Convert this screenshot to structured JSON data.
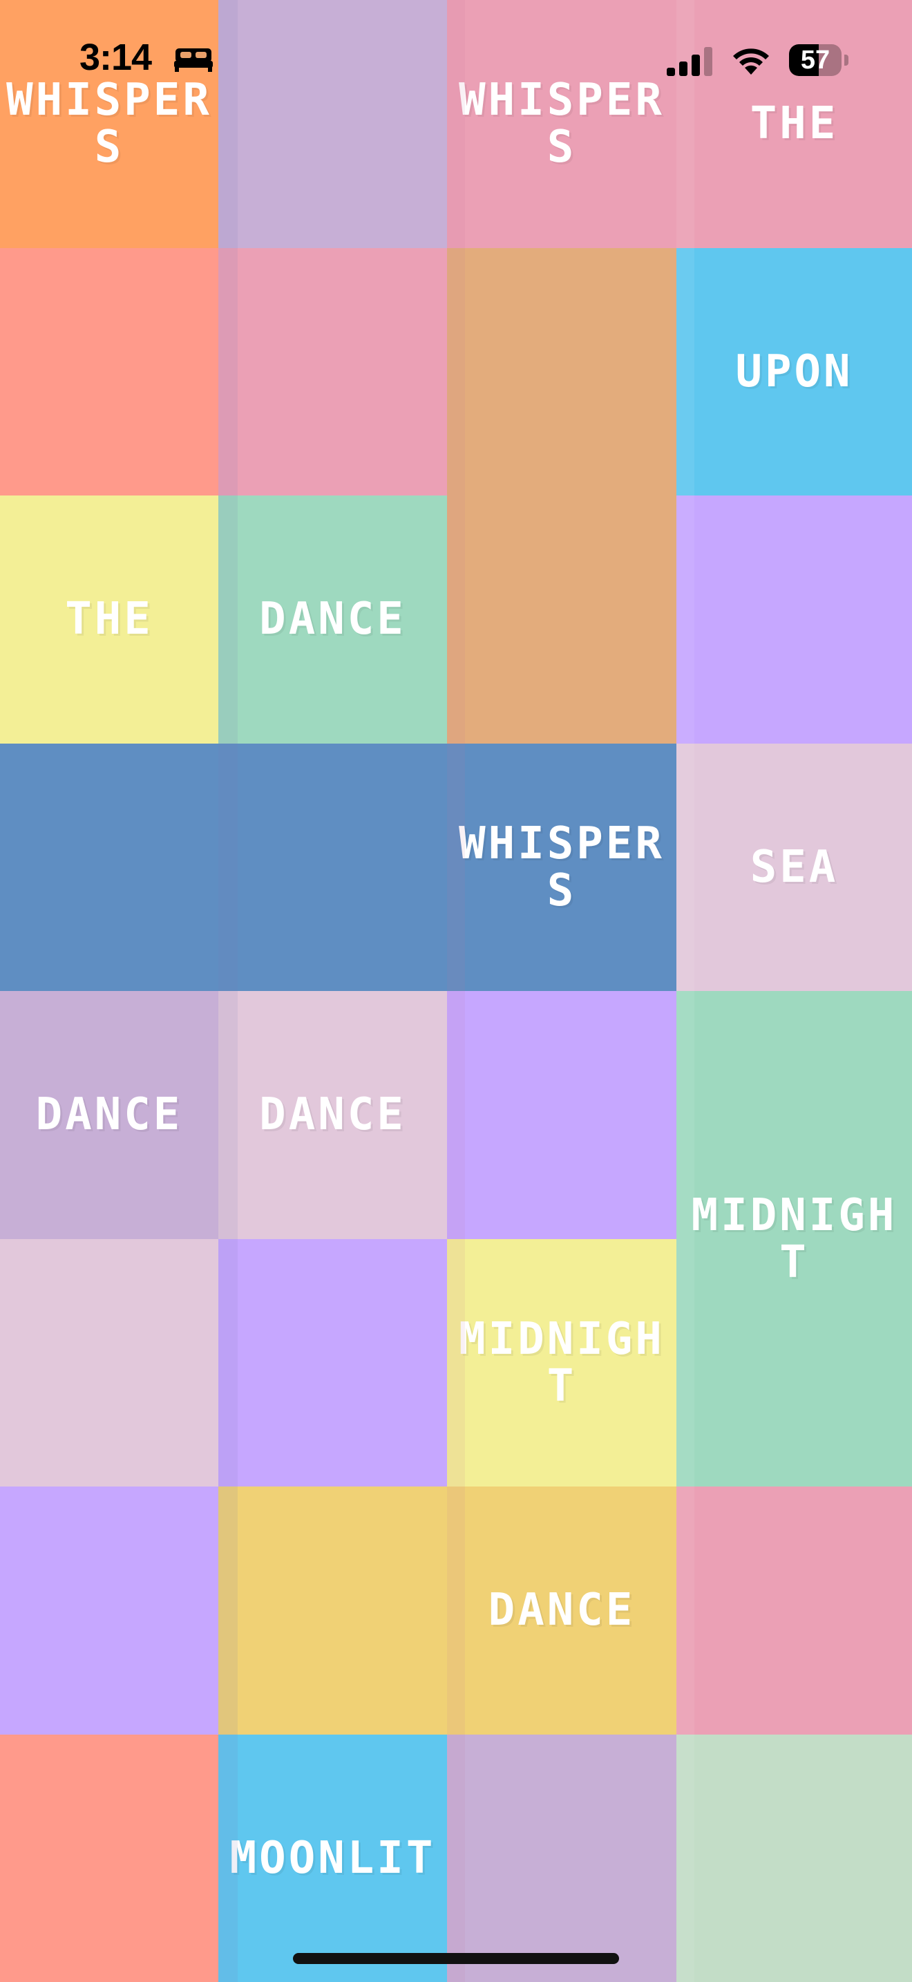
{
  "status_bar": {
    "time": "3:14",
    "battery_level": 57,
    "battery_label": "57"
  },
  "tiles": [
    {
      "word": "WHISPERS",
      "color": "#ffa162"
    },
    {
      "word": "",
      "color": "#c7afd6"
    },
    {
      "word": "WHISPERS",
      "color": "#eba0b5"
    },
    {
      "word": "THE",
      "color": "#eba0b5"
    },
    {
      "word": "",
      "color": "#ff9a8b"
    },
    {
      "word": "",
      "color": "#eba0b5"
    },
    {
      "word": "",
      "color": "#e3ac7c",
      "rowspan": 2
    },
    {
      "word": "UPON",
      "color": "#5fc7ef"
    },
    {
      "word": "THE",
      "color": "#f3ef96"
    },
    {
      "word": "DANCE",
      "color": "#9ed9bf"
    },
    {
      "word": "",
      "color": "#c6a7ff"
    },
    {
      "word": "",
      "color": "#5f8ec2"
    },
    {
      "word": "",
      "color": "#5f8ec2"
    },
    {
      "word": "WHISPERS",
      "color": "#5f8ec2"
    },
    {
      "word": "SEA",
      "color": "#e2c8db"
    },
    {
      "word": "DANCE",
      "color": "#c7afd6"
    },
    {
      "word": "DANCE",
      "color": "#e2c8db"
    },
    {
      "word": "",
      "color": "#c6a7ff"
    },
    {
      "word": "MIDNIGHT",
      "color": "#9ed9bf",
      "rowspan": 2
    },
    {
      "word": "",
      "color": "#e2c8db"
    },
    {
      "word": "",
      "color": "#c6a7ff"
    },
    {
      "word": "MIDNIGHT",
      "color": "#f3ef96"
    },
    {
      "word": "",
      "color": "#c6a7ff"
    },
    {
      "word": "",
      "color": "#f0d175"
    },
    {
      "word": "DANCE",
      "color": "#f0d175"
    },
    {
      "word": "",
      "color": "#eba0b5"
    },
    {
      "word": "",
      "color": "#ff9a8b"
    },
    {
      "word": "MOONLIT",
      "color": "#5fc7ef"
    },
    {
      "word": "",
      "color": "#c7afd6"
    },
    {
      "word": "",
      "color": "#c3ddc7"
    }
  ]
}
